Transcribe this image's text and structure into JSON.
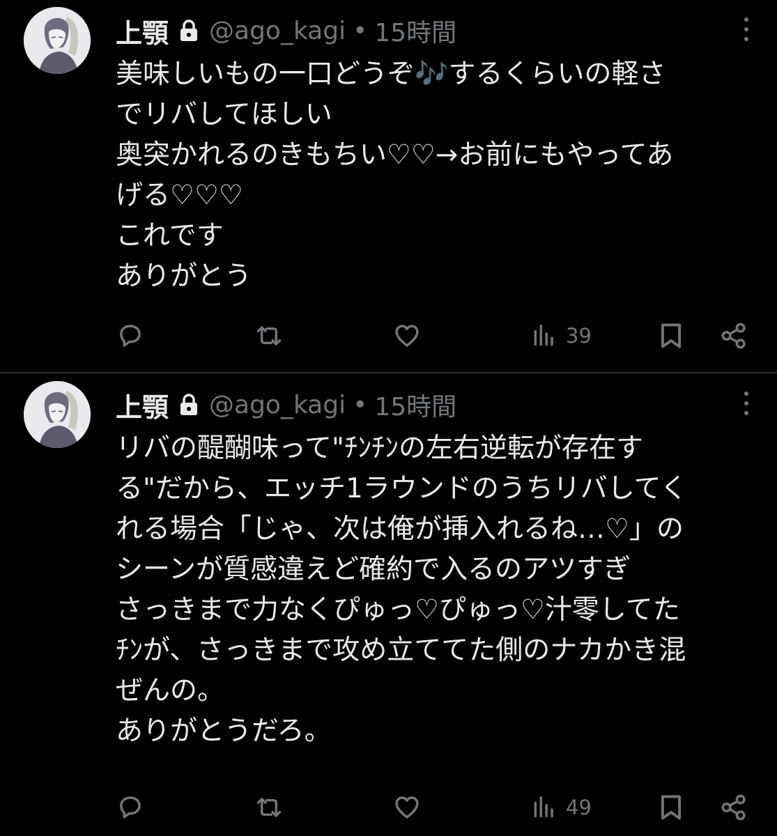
{
  "tweets": [
    {
      "display_name": "上顎",
      "handle": "@ago_kagi",
      "separator": "•",
      "time": "15時間",
      "text": "美味しいもの一口どうぞ🎶するくらいの軽さ\nでリバしてほしい\n奥突かれるのきもちい♡♡→お前にもやってあ\nげる♡♡♡\nこれです\nありがとう",
      "views": "39",
      "icons": [
        "reply-icon",
        "retweet-icon",
        "like-icon",
        "views-icon",
        "bookmark-icon",
        "share-icon"
      ]
    },
    {
      "display_name": "上顎",
      "handle": "@ago_kagi",
      "separator": "•",
      "time": "15時間",
      "text": "リバの醍醐味って\"ﾁﾝﾁﾝの左右逆転が存在す\nる\"だから、エッチ1ラウンドのうちリバしてく\nれる場合「じゃ、次は俺が挿入れるね…♡」の\nシーンが質感違えど確約で入るのアツすぎ\nさっきまで力なくぴゅっ♡ぴゅっ♡汁零してた\nﾁﾝが、さっきまで攻め立ててた側のナカかき混\nぜんの。\nありがとうだろ。",
      "views": "49",
      "icons": [
        "reply-icon",
        "retweet-icon",
        "like-icon",
        "views-icon",
        "bookmark-icon",
        "share-icon"
      ]
    }
  ],
  "colors": {
    "background": "#000000",
    "text": "#e7e9ea",
    "secondary": "#71767b",
    "divider": "#2f3336"
  }
}
